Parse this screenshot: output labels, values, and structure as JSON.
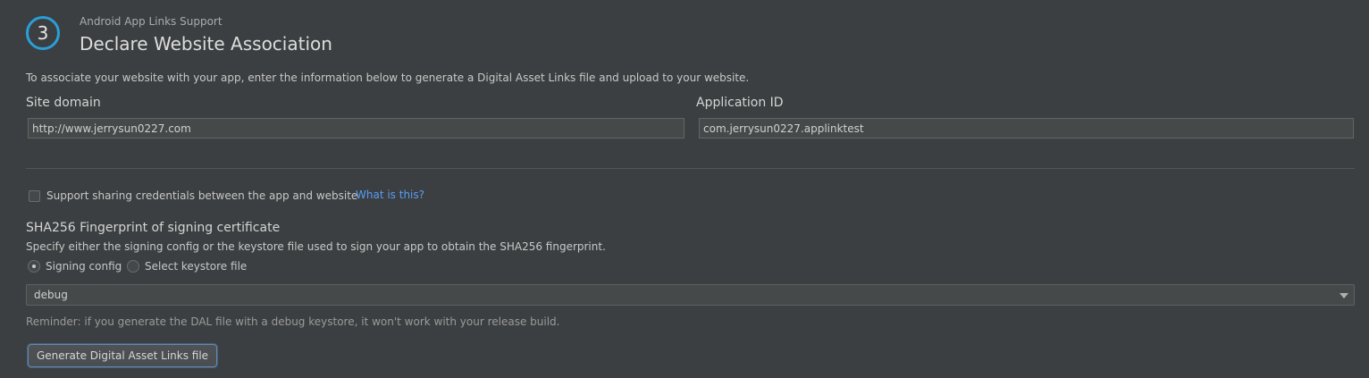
{
  "header": {
    "step_number": "3",
    "subtitle": "Android App Links Support",
    "title": "Declare Website Association"
  },
  "intro_text": "To associate your website with your app, enter the information below to generate a Digital Asset Links file and upload to your website.",
  "site_domain": {
    "label": "Site domain",
    "value": "http://www.jerrysun0227.com"
  },
  "application_id": {
    "label": "Application ID",
    "value": "com.jerrysun0227.applinktest"
  },
  "share_credentials": {
    "label": "Support sharing credentials between the app and website",
    "checked": false,
    "link_text": "What is this?"
  },
  "fingerprint": {
    "title": "SHA256 Fingerprint of signing certificate",
    "description": "Specify either the signing config or the keystore file used to sign your app to obtain the SHA256 fingerprint.",
    "options": [
      {
        "label": "Signing config",
        "selected": true
      },
      {
        "label": "Select keystore file",
        "selected": false
      }
    ],
    "signing_config_value": "debug",
    "reminder": "Reminder: if you generate the DAL file with a debug keystore, it won't work with your release build."
  },
  "generate_button_label": "Generate Digital Asset Links file",
  "colors": {
    "background": "#3c3f41",
    "accent": "#2a9fd8",
    "link": "#589df6"
  }
}
